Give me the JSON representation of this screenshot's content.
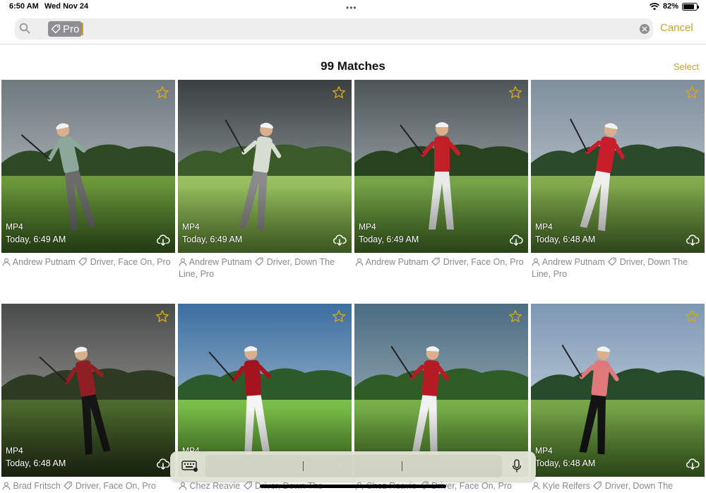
{
  "status_bar": {
    "time": "6:50 AM",
    "date": "Wed Nov 24",
    "battery": "82%",
    "battery_level": 0.82
  },
  "search": {
    "token_label": "Pro",
    "token_icon": "tag-icon",
    "cancel_label": "Cancel"
  },
  "header": {
    "matches": "99 Matches",
    "select_label": "Select"
  },
  "accent_color": "#c9a227",
  "videos": [
    {
      "format": "MP4",
      "time": "Today, 6:49 AM",
      "user": "Andrew Putnam",
      "tags_line1": "Driver, Face On, Pro",
      "tags_line2": ""
    },
    {
      "format": "MP4",
      "time": "Today, 6:49 AM",
      "user": "Andrew Putnam",
      "tags_line1": "Driver, Down The",
      "tags_line2": "Line, Pro"
    },
    {
      "format": "MP4",
      "time": "Today, 6:49 AM",
      "user": "Andrew Putnam",
      "tags_line1": "Driver, Face On, Pro",
      "tags_line2": ""
    },
    {
      "format": "MP4",
      "time": "Today, 6:48 AM",
      "user": "Andrew Putnam",
      "tags_line1": "Driver, Down The",
      "tags_line2": "Line, Pro"
    },
    {
      "format": "MP4",
      "time": "Today, 6:48 AM",
      "user": "Brad Fritsch",
      "tags_line1": "Driver, Face On, Pro",
      "tags_line2": ""
    },
    {
      "format": "MP4",
      "time": "",
      "user": "Chez Reavie",
      "tags_line1": "Driver, Down The",
      "tags_line2": ""
    },
    {
      "format": "",
      "time": "",
      "user": "Chez Reavie",
      "tags_line1": "Driver, Face On, Pro",
      "tags_line2": ""
    },
    {
      "format": "MP4",
      "time": "Today, 6:48 AM",
      "user": "Kyle Reifers",
      "tags_line1": "Driver, Down The",
      "tags_line2": ""
    }
  ]
}
